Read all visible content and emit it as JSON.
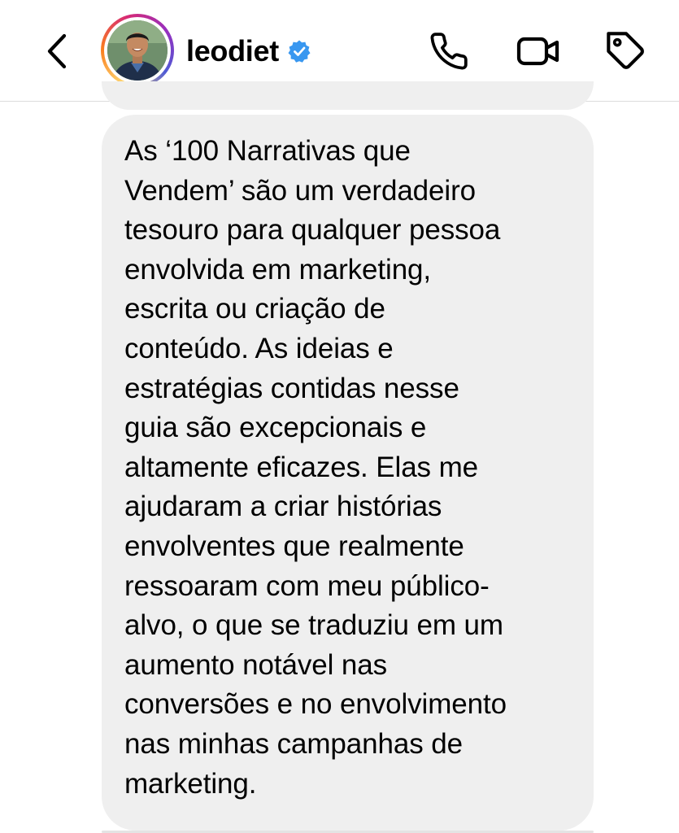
{
  "header": {
    "username": "leodiet",
    "verified": true,
    "icons": {
      "back": "chevron-left-icon",
      "call": "phone-icon",
      "video": "video-camera-icon",
      "tag": "tag-icon",
      "verified": "verified-badge-icon"
    },
    "colors": {
      "verified_blue": "#3897f0",
      "ring_gradient": [
        "#feda75",
        "#fa7e1e",
        "#d62976",
        "#962fbf",
        "#4f5bd5"
      ]
    }
  },
  "message": {
    "text": "As ‘100 Narrativas que\nVendem’ são um verdadeiro\ntesouro para qualquer pessoa\nenvolvida em marketing,\nescrita ou criação de\nconteúdo. As ideias e\nestratégias contidas nesse\nguia são excepcionais e\naltamente eficazes. Elas me\najudaram a criar histórias\nenvolventes que realmente\nressoaram com meu público-\nalvo, o que se traduziu em um\naumento notável nas\nconversões e no envolvimento\nnas minhas campanhas de\nmarketing.",
    "bubble_color": "#efefef"
  }
}
